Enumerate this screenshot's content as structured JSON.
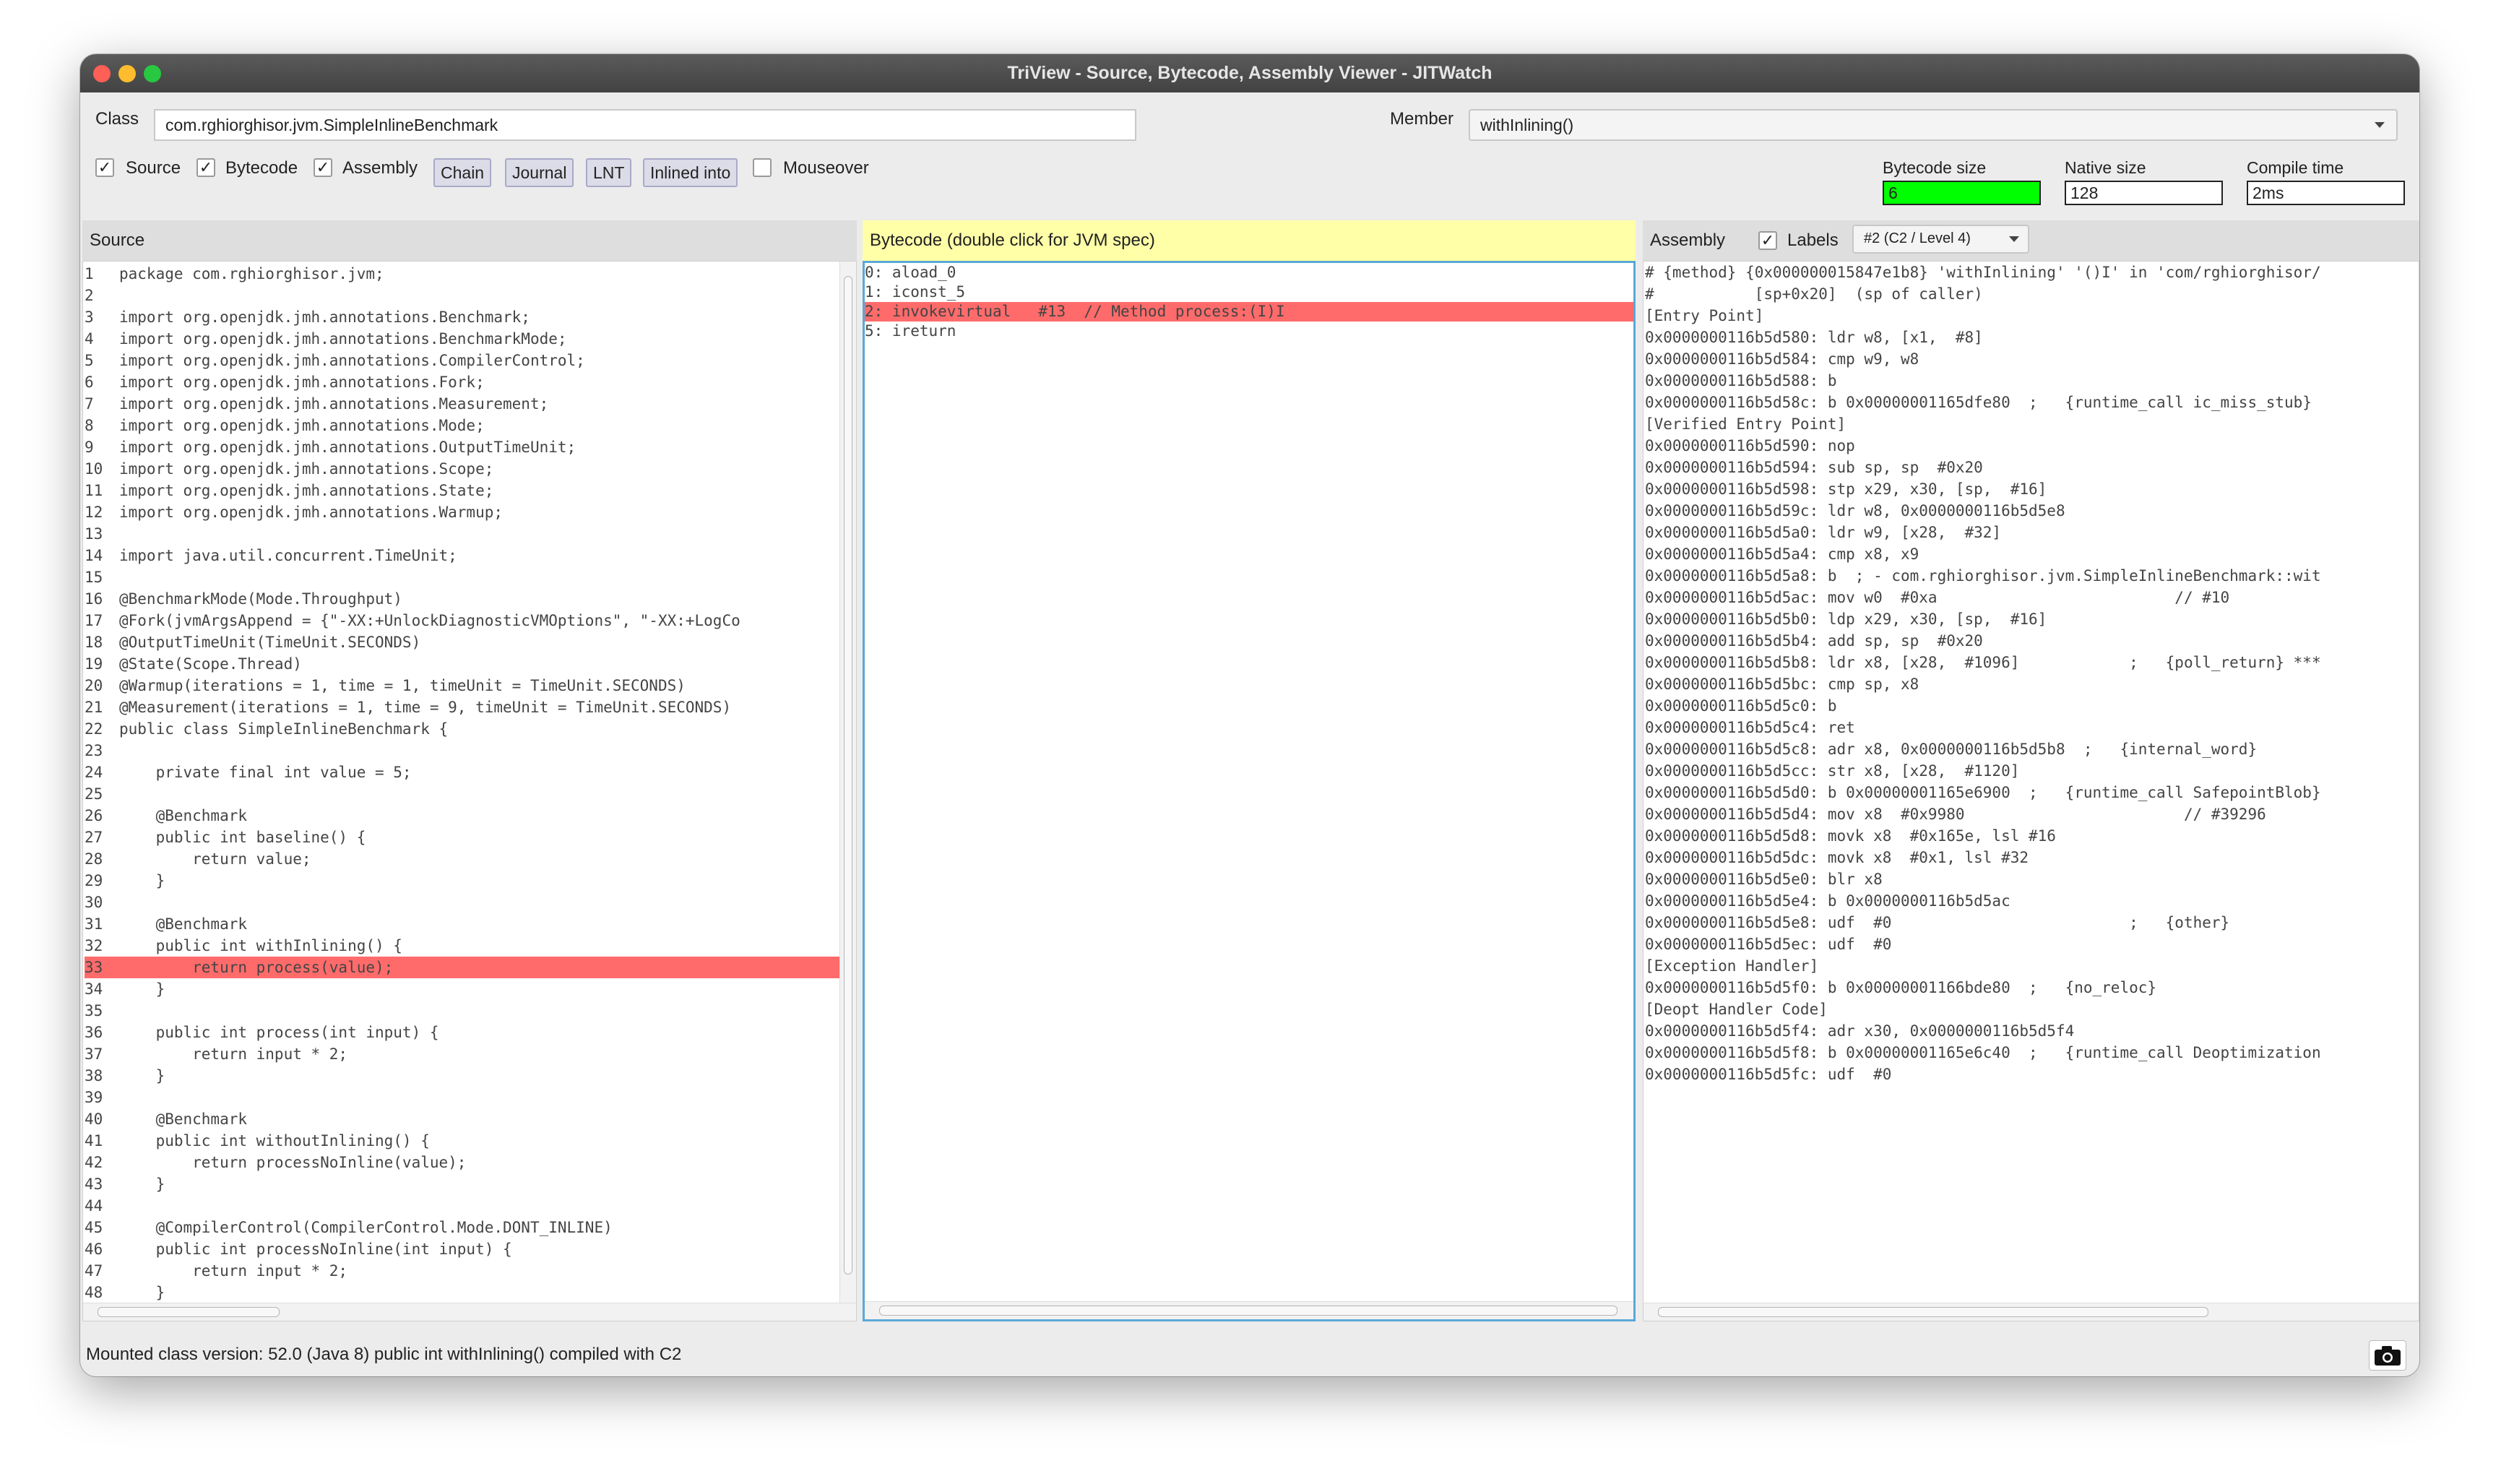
{
  "window": {
    "title": "TriView - Source, Bytecode, Assembly Viewer - JITWatch"
  },
  "toolbar": {
    "class_label": "Class",
    "class_value": "com.rghiorghisor.jvm.SimpleInlineBenchmark",
    "member_label": "Member",
    "member_value": "withInlining()",
    "checkboxes": [
      {
        "label": "Source",
        "checked": true
      },
      {
        "label": "Bytecode",
        "checked": true
      },
      {
        "label": "Assembly",
        "checked": true
      }
    ],
    "buttons": [
      "Chain",
      "Journal",
      "LNT",
      "Inlined into"
    ],
    "mouseover": {
      "label": "Mouseover",
      "checked": false
    },
    "stats": [
      {
        "label": "Bytecode size",
        "value": "6",
        "color": "#00ff00"
      },
      {
        "label": "Native size",
        "value": "128",
        "color": "#ffffff"
      },
      {
        "label": "Compile time",
        "value": "2ms",
        "color": "#ffffff"
      }
    ]
  },
  "source": {
    "title": "Source",
    "highlight_line": 33,
    "lines": [
      "package com.rghiorghisor.jvm;",
      "",
      "import org.openjdk.jmh.annotations.Benchmark;",
      "import org.openjdk.jmh.annotations.BenchmarkMode;",
      "import org.openjdk.jmh.annotations.CompilerControl;",
      "import org.openjdk.jmh.annotations.Fork;",
      "import org.openjdk.jmh.annotations.Measurement;",
      "import org.openjdk.jmh.annotations.Mode;",
      "import org.openjdk.jmh.annotations.OutputTimeUnit;",
      "import org.openjdk.jmh.annotations.Scope;",
      "import org.openjdk.jmh.annotations.State;",
      "import org.openjdk.jmh.annotations.Warmup;",
      "",
      "import java.util.concurrent.TimeUnit;",
      "",
      "@BenchmarkMode(Mode.Throughput)",
      "@Fork(jvmArgsAppend = {\"-XX:+UnlockDiagnosticVMOptions\", \"-XX:+LogCo",
      "@OutputTimeUnit(TimeUnit.SECONDS)",
      "@State(Scope.Thread)",
      "@Warmup(iterations = 1, time = 1, timeUnit = TimeUnit.SECONDS)",
      "@Measurement(iterations = 1, time = 9, timeUnit = TimeUnit.SECONDS)",
      "public class SimpleInlineBenchmark {",
      "",
      "    private final int value = 5;",
      "",
      "    @Benchmark",
      "    public int baseline() {",
      "        return value;",
      "    }",
      "",
      "    @Benchmark",
      "    public int withInlining() {",
      "        return process(value);",
      "    }",
      "",
      "    public int process(int input) {",
      "        return input * 2;",
      "    }",
      "",
      "    @Benchmark",
      "    public int withoutInlining() {",
      "        return processNoInline(value);",
      "    }",
      "",
      "    @CompilerControl(CompilerControl.Mode.DONT_INLINE)",
      "    public int processNoInline(int input) {",
      "        return input * 2;",
      "    }"
    ]
  },
  "bytecode": {
    "title": "Bytecode (double click for JVM spec)",
    "highlight_index": 2,
    "lines": [
      "0: aload_0",
      "1: iconst_5",
      "2: invokevirtual   #13  // Method process:(I)I",
      "5: ireturn"
    ]
  },
  "assembly": {
    "title": "Assembly",
    "labels_label": "Labels",
    "labels_checked": true,
    "compile_select": "#2  (C2 / Level 4)",
    "lines": [
      "# {method} {0x000000015847e1b8} 'withInlining' '()I' in 'com/rghiorghisor/",
      "#           [sp+0x20]  (sp of caller)",
      "[Entry Point]",
      "0x0000000116b5d580: ldr w8, [x1,  #8]",
      "0x0000000116b5d584: cmp w9, w8",
      "0x0000000116b5d588: b",
      "0x0000000116b5d58c: b 0x00000001165dfe80  ;   {runtime_call ic_miss_stub}",
      "[Verified Entry Point]",
      "0x0000000116b5d590: nop",
      "0x0000000116b5d594: sub sp, sp  #0x20",
      "0x0000000116b5d598: stp x29, x30, [sp,  #16]",
      "0x0000000116b5d59c: ldr w8, 0x0000000116b5d5e8",
      "0x0000000116b5d5a0: ldr w9, [x28,  #32]",
      "0x0000000116b5d5a4: cmp x8, x9",
      "0x0000000116b5d5a8: b  ; - com.rghiorghisor.jvm.SimpleInlineBenchmark::wit",
      "0x0000000116b5d5ac: mov w0  #0xa                          // #10",
      "0x0000000116b5d5b0: ldp x29, x30, [sp,  #16]",
      "0x0000000116b5d5b4: add sp, sp  #0x20",
      "0x0000000116b5d5b8: ldr x8, [x28,  #1096]            ;   {poll_return} ***",
      "0x0000000116b5d5bc: cmp sp, x8",
      "0x0000000116b5d5c0: b",
      "0x0000000116b5d5c4: ret",
      "0x0000000116b5d5c8: adr x8, 0x0000000116b5d5b8  ;   {internal_word}",
      "0x0000000116b5d5cc: str x8, [x28,  #1120]",
      "0x0000000116b5d5d0: b 0x00000001165e6900  ;   {runtime_call SafepointBlob}",
      "0x0000000116b5d5d4: mov x8  #0x9980                        // #39296",
      "0x0000000116b5d5d8: movk x8  #0x165e, lsl #16",
      "0x0000000116b5d5dc: movk x8  #0x1, lsl #32",
      "0x0000000116b5d5e0: blr x8",
      "0x0000000116b5d5e4: b 0x0000000116b5d5ac",
      "0x0000000116b5d5e8: udf  #0                          ;   {other}",
      "0x0000000116b5d5ec: udf  #0",
      "[Exception Handler]",
      "0x0000000116b5d5f0: b 0x00000001166bde80  ;   {no_reloc}",
      "[Deopt Handler Code]",
      "0x0000000116b5d5f4: adr x30, 0x0000000116b5d5f4",
      "0x0000000116b5d5f8: b 0x00000001165e6c40  ;   {runtime_call Deoptimization",
      "0x0000000116b5d5fc: udf  #0"
    ]
  },
  "status": {
    "text": "Mounted class version: 52.0 (Java 8) public int withInlining() compiled with C2"
  },
  "icons": {
    "snapshot": "camera-icon",
    "check": "✓"
  }
}
